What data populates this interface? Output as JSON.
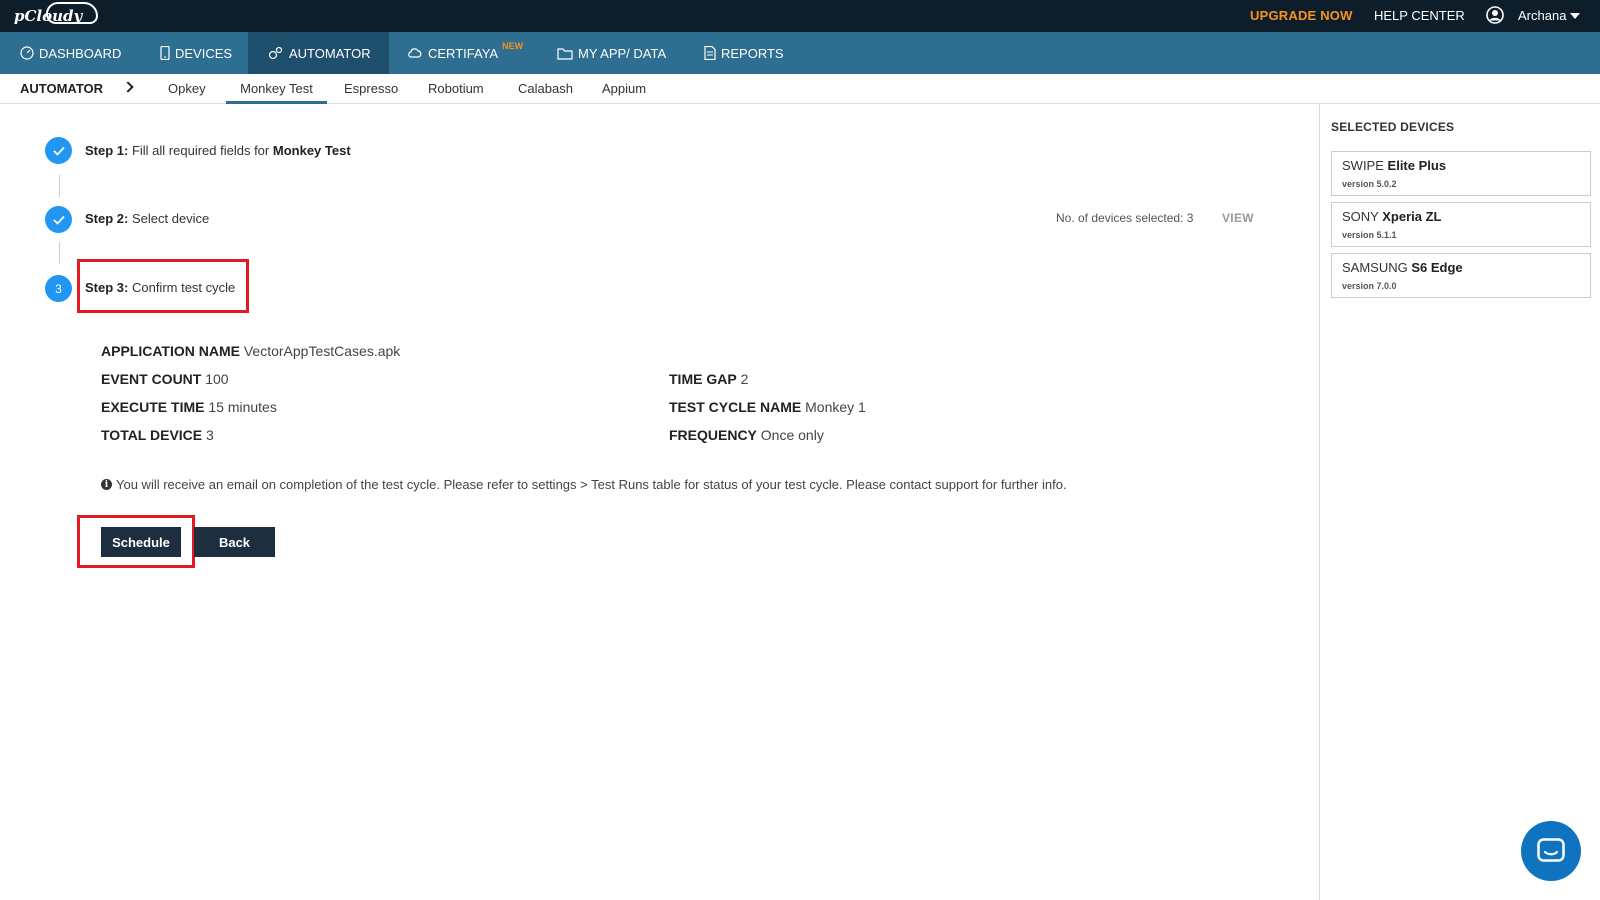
{
  "topbar": {
    "logo": "pCloudy",
    "upgrade": "UPGRADE NOW",
    "help": "HELP CENTER",
    "user": "Archana"
  },
  "nav": [
    {
      "label": "DASHBOARD",
      "icon": "dashboard-icon"
    },
    {
      "label": "DEVICES",
      "icon": "mobile-icon"
    },
    {
      "label": "AUTOMATOR",
      "icon": "gears-icon",
      "active": true
    },
    {
      "label": "CERTIFAYA",
      "icon": "cloud-gear-icon",
      "badge": "NEW"
    },
    {
      "label": "MY APP/ DATA",
      "icon": "folder-icon"
    },
    {
      "label": "REPORTS",
      "icon": "document-icon"
    }
  ],
  "subnav": {
    "title": "AUTOMATOR",
    "tabs": [
      "Opkey",
      "Monkey Test",
      "Espresso",
      "Robotium",
      "Calabash",
      "Appium"
    ],
    "active": "Monkey Test"
  },
  "steps": {
    "s1_label": "Step 1:",
    "s1_text": "Fill all required fields for",
    "s1_bold": "Monkey Test",
    "s2_label": "Step 2:",
    "s2_text": "Select device",
    "s3_num": "3",
    "s3_label": "Step 3:",
    "s3_text": "Confirm test cycle",
    "devices_selected": "No. of devices selected: 3",
    "view": "VIEW"
  },
  "details": {
    "app_name_label": "APPLICATION NAME",
    "app_name": "VectorAppTestCases.apk",
    "event_count_label": "EVENT COUNT",
    "event_count": "100",
    "time_gap_label": "TIME GAP",
    "time_gap": "2",
    "execute_time_label": "EXECUTE TIME",
    "execute_time": "15 minutes",
    "test_cycle_label": "TEST CYCLE NAME",
    "test_cycle": "Monkey 1",
    "total_device_label": "TOTAL DEVICE",
    "total_device": "3",
    "frequency_label": "FREQUENCY",
    "frequency": "Once only",
    "info": "You will receive an email on completion of the test cycle. Please refer to settings > Test Runs table for status of your test cycle. Please contact support for further info."
  },
  "buttons": {
    "schedule": "Schedule",
    "back": "Back"
  },
  "selected_devices": {
    "title": "SELECTED DEVICES",
    "items": [
      {
        "brand": "SWIPE",
        "model": "Elite Plus",
        "version": "version 5.0.2"
      },
      {
        "brand": "SONY",
        "model": "Xperia ZL",
        "version": "version 5.1.1"
      },
      {
        "brand": "SAMSUNG",
        "model": "S6 Edge",
        "version": "version 7.0.0"
      }
    ]
  },
  "colors": {
    "topbar": "#0d1e2a",
    "nav": "#2e6e91",
    "nav_active": "#1e4f6c",
    "accent_orange": "#f7931e",
    "step_blue": "#2196f3",
    "highlight_red": "#e01b24",
    "button": "#1c2e40"
  }
}
